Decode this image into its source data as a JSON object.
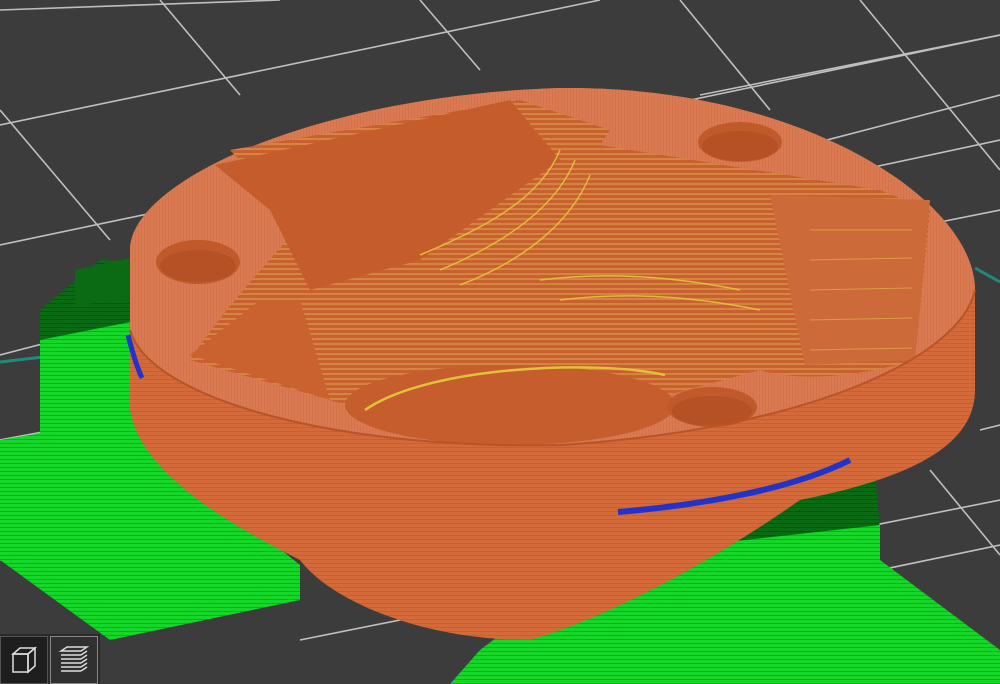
{
  "app": {
    "view": "gcode-preview"
  },
  "colors": {
    "background": "#3c3c3c",
    "grid_line": "#bfbfbf",
    "axis_teal": "#1f8a7a",
    "part_orange": "#d4693a",
    "part_orange_dark": "#b85526",
    "part_orange_light": "#dc7e55",
    "support_green": "#16d62a",
    "support_green_dark": "#0a6b14",
    "support_interface_dark": "#0b5a10",
    "bridge_blue": "#2233cc",
    "overhang_yellow": "#e3c43a"
  },
  "toolbar": {
    "buttons": [
      {
        "name": "3d-view-button",
        "icon": "cube-icon",
        "active": false
      },
      {
        "name": "layers-view-button",
        "icon": "layers-icon",
        "active": true
      }
    ]
  }
}
